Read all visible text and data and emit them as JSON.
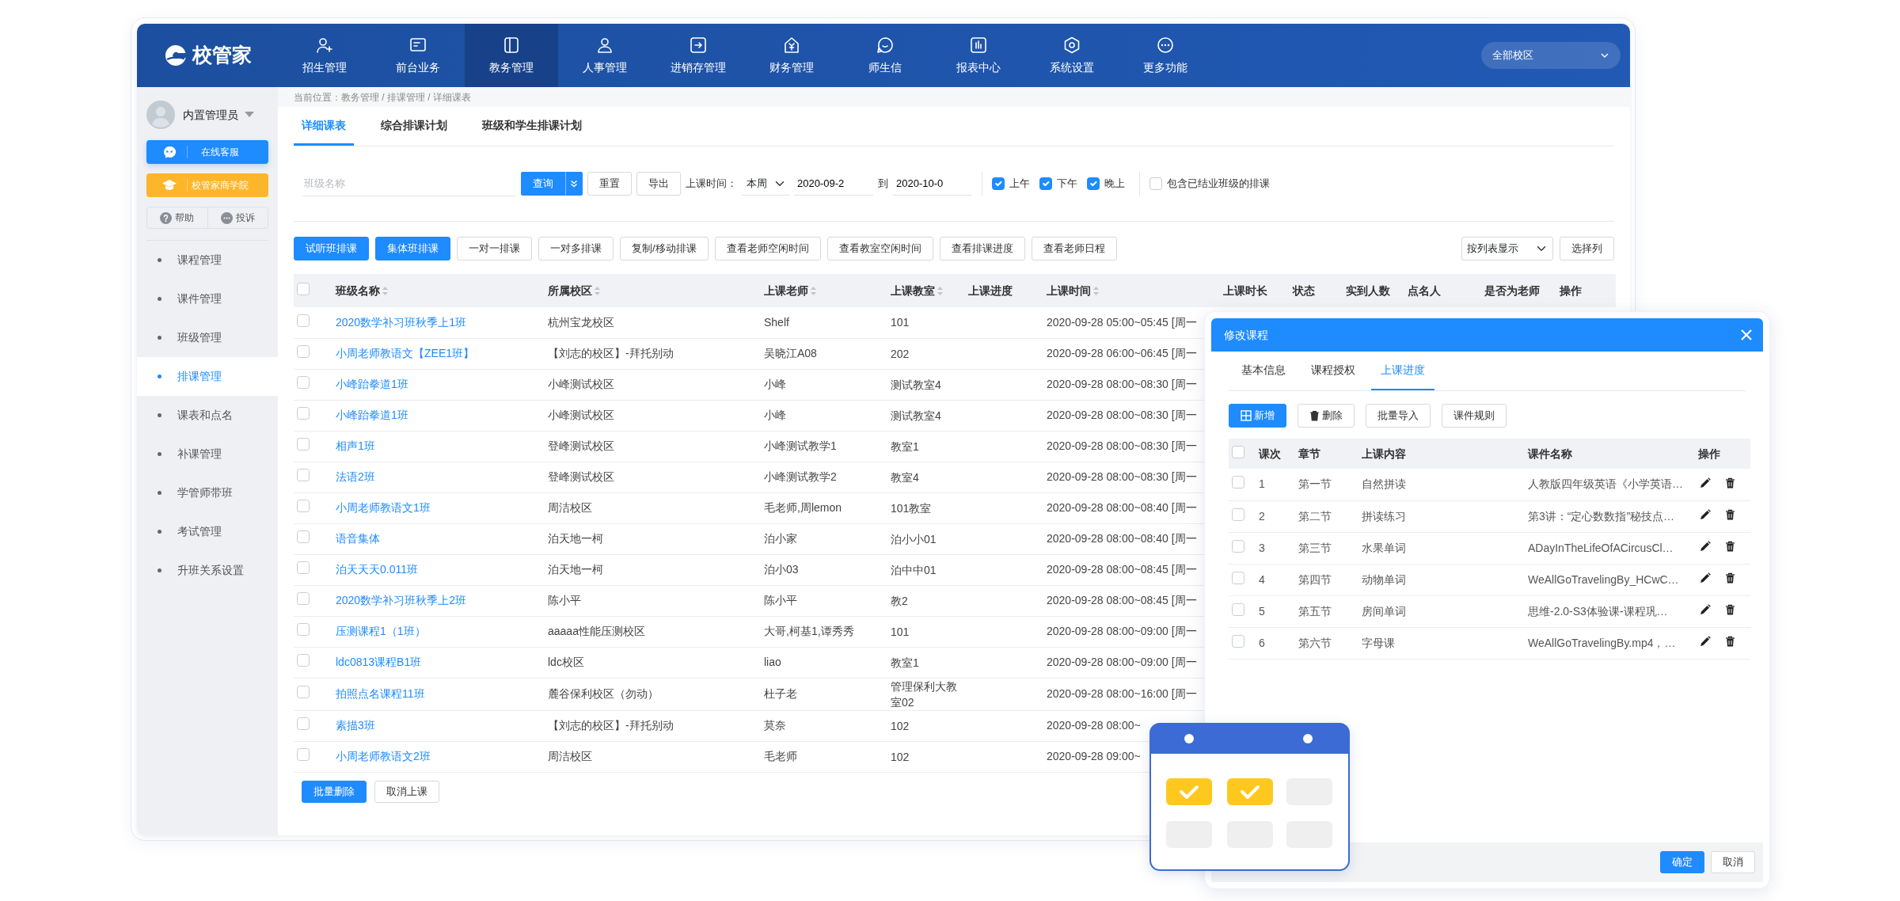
{
  "brand": "校管家",
  "nav": {
    "items": [
      {
        "label": "招生管理",
        "selected": false
      },
      {
        "label": "前台业务",
        "selected": false
      },
      {
        "label": "教务管理",
        "selected": true
      },
      {
        "label": "人事管理",
        "selected": false
      },
      {
        "label": "进销存管理",
        "selected": false
      },
      {
        "label": "财务管理",
        "selected": false
      },
      {
        "label": "师生信",
        "selected": false
      },
      {
        "label": "报表中心",
        "selected": false
      },
      {
        "label": "系统设置",
        "selected": false
      },
      {
        "label": "更多功能",
        "selected": false
      }
    ],
    "campus": "全部校区"
  },
  "sidebar": {
    "user": "内置管理员",
    "service": "在线客服",
    "academy": "校管家商学院",
    "help": "帮助",
    "complaint": "投诉",
    "menu": [
      {
        "label": "课程管理",
        "selected": false
      },
      {
        "label": "课件管理",
        "selected": false
      },
      {
        "label": "班级管理",
        "selected": false
      },
      {
        "label": "排课管理",
        "selected": true
      },
      {
        "label": "课表和点名",
        "selected": false
      },
      {
        "label": "补课管理",
        "selected": false
      },
      {
        "label": "学管师带班",
        "selected": false
      },
      {
        "label": "考试管理",
        "selected": false
      },
      {
        "label": "升班关系设置",
        "selected": false
      }
    ]
  },
  "breadcrumb": "当前位置：教务管理 / 排课管理 / 详细课表",
  "tabs": [
    {
      "label": "详细课表",
      "selected": true
    },
    {
      "label": "综合排课计划",
      "selected": false
    },
    {
      "label": "班级和学生排课计划",
      "selected": false
    }
  ],
  "filters": {
    "placeholder": "班级名称",
    "query": "查询",
    "reset": "重置",
    "export": "导出",
    "time_label": "上课时间：",
    "period": "本周",
    "date_from": "2020-09-2",
    "to": "到",
    "date_to": "2020-10-0",
    "periods": [
      {
        "label": "上午",
        "checked": true
      },
      {
        "label": "下午",
        "checked": true
      },
      {
        "label": "晚上",
        "checked": true
      }
    ],
    "include_ended": {
      "label": "包含已结业班级的排课",
      "checked": false
    }
  },
  "actions": [
    {
      "label": "试听班排课",
      "kind": "primary"
    },
    {
      "label": "集体班排课",
      "kind": "primary"
    },
    {
      "label": "一对一排课",
      "kind": "default"
    },
    {
      "label": "一对多排课",
      "kind": "default"
    },
    {
      "label": "复制/移动排课",
      "kind": "default"
    },
    {
      "label": "查看老师空闲时间",
      "kind": "default"
    },
    {
      "label": "查看教室空闲时间",
      "kind": "default"
    },
    {
      "label": "查看排课进度",
      "kind": "default"
    },
    {
      "label": "查看老师日程",
      "kind": "default"
    }
  ],
  "view_mode": "按列表显示",
  "choose_columns": "选择列",
  "table": {
    "all_checked": false,
    "columns": [
      {
        "label": "班级名称",
        "sortable": true
      },
      {
        "label": "所属校区",
        "sortable": true
      },
      {
        "label": "上课老师",
        "sortable": true
      },
      {
        "label": "上课教室",
        "sortable": true
      },
      {
        "label": "上课进度",
        "sortable": false
      },
      {
        "label": "上课时间",
        "sortable": true
      },
      {
        "label": "上课时长",
        "sortable": false
      },
      {
        "label": "状态",
        "sortable": false
      },
      {
        "label": "实到人数",
        "sortable": false
      },
      {
        "label": "点名人",
        "sortable": false
      },
      {
        "label": "是否为老师",
        "sortable": false
      },
      {
        "label": "操作",
        "sortable": false
      }
    ],
    "rows": [
      {
        "checked": false,
        "class": "2020数学补习班秋季上1班",
        "campus": "杭州宝龙校区",
        "teacher": "Shelf",
        "room": "101",
        "time": "2020-09-28 05:00~05:45 [周一"
      },
      {
        "checked": false,
        "class": "小周老师教语文【ZEE1班】",
        "campus": "【刘志的校区】-拜托别动",
        "teacher": "吴晓江A08",
        "room": "202",
        "time": "2020-09-28 06:00~06:45 [周一"
      },
      {
        "checked": false,
        "class": "小峰跆拳道1班",
        "campus": "小峰测试校区",
        "teacher": "小峰",
        "room": "测试教室4",
        "time": "2020-09-28 08:00~08:30 [周一"
      },
      {
        "checked": false,
        "class": "小峰跆拳道1班",
        "campus": "小峰测试校区",
        "teacher": "小峰",
        "room": "测试教室4",
        "time": "2020-09-28 08:00~08:30 [周一"
      },
      {
        "checked": false,
        "class": "相声1班",
        "campus": "登峰测试校区",
        "teacher": "小峰测试教学1",
        "room": "教室1",
        "time": "2020-09-28 08:00~08:30 [周一"
      },
      {
        "checked": false,
        "class": "法语2班",
        "campus": "登峰测试校区",
        "teacher": "小峰测试教学2",
        "room": "教室4",
        "time": "2020-09-28 08:00~08:30 [周一"
      },
      {
        "checked": false,
        "class": "小周老师教语文1班",
        "campus": "周洁校区",
        "teacher": "毛老师,周lemon",
        "room": "101教室",
        "time": "2020-09-28 08:00~08:40 [周一"
      },
      {
        "checked": false,
        "class": "语音集体",
        "campus": "泊天地一柯",
        "teacher": "泊小家",
        "room": "泊小小01",
        "time": "2020-09-28 08:00~08:40 [周一"
      },
      {
        "checked": false,
        "class": "泊天天天0.011班",
        "campus": "泊天地一柯",
        "teacher": "泊小03",
        "room": "泊中中01",
        "time": "2020-09-28 08:00~08:45 [周一"
      },
      {
        "checked": false,
        "class": "2020数学补习班秋季上2班",
        "campus": "陈小平",
        "teacher": "陈小平",
        "room": "教2",
        "time": "2020-09-28 08:00~08:45 [周一"
      },
      {
        "checked": false,
        "class": "压测课程1（1班）",
        "campus": "aaaaa性能压测校区",
        "teacher": "大哥,柯基1,谭秀秀",
        "room": "101",
        "time": "2020-09-28 08:00~09:00 [周一"
      },
      {
        "checked": false,
        "class": "ldc0813课程B1班",
        "campus": "ldc校区",
        "teacher": "liao",
        "room": "教室1",
        "time": "2020-09-28 08:00~09:00 [周一"
      },
      {
        "checked": false,
        "class": "拍照点名课程11班",
        "campus": "麓谷保利校区（勿动）",
        "teacher": "杜子老",
        "room": "管理保利大教室02",
        "time": "2020-09-28 08:00~16:00 [周一"
      },
      {
        "checked": false,
        "class": "素描3班",
        "campus": "【刘志的校区】-拜托别动",
        "teacher": "莫奈",
        "room": "102",
        "time": "2020-09-28 08:00~"
      },
      {
        "checked": false,
        "class": "小周老师教语文2班",
        "campus": "周洁校区",
        "teacher": "毛老师",
        "room": "102",
        "time": "2020-09-28 09:00~"
      }
    ]
  },
  "bulk_buttons": [
    {
      "label": "批量删除",
      "kind": "primary"
    },
    {
      "label": "取消上课",
      "kind": "default"
    }
  ],
  "modal": {
    "title": "修改课程",
    "all_checked": false,
    "tabs": [
      {
        "label": "基本信息",
        "selected": false
      },
      {
        "label": "课程授权",
        "selected": false
      },
      {
        "label": "上课进度",
        "selected": true
      }
    ],
    "buttons": [
      {
        "label": "新增",
        "kind": "add"
      },
      {
        "label": "删除",
        "kind": "delete"
      },
      {
        "label": "批量导入",
        "kind": "plain"
      },
      {
        "label": "课件规则",
        "kind": "plain"
      }
    ],
    "columns": [
      "课次",
      "章节",
      "上课内容",
      "课件名称",
      "操作"
    ],
    "rows": [
      {
        "checked": false,
        "no": "1",
        "chapter": "第一节",
        "content": "自然拼读",
        "file": "人教版四年级英语《小学英语…"
      },
      {
        "checked": false,
        "no": "2",
        "chapter": "第二节",
        "content": "拼读练习",
        "file": "第3讲：“定心数数指”秘技点…"
      },
      {
        "checked": false,
        "no": "3",
        "chapter": "第三节",
        "content": "水果单词",
        "file": "ADayInTheLifeOfACircusCl…"
      },
      {
        "checked": false,
        "no": "4",
        "chapter": "第四节",
        "content": "动物单词",
        "file": "WeAllGoTravelingBy_HCwC…"
      },
      {
        "checked": false,
        "no": "5",
        "chapter": "第五节",
        "content": "房间单词",
        "file": "思维-2.0-S3体验课-课程巩…"
      },
      {
        "checked": false,
        "no": "6",
        "chapter": "第六节",
        "content": "字母课",
        "file": "WeAllGoTravelingBy.mp4，…"
      }
    ],
    "confirm": "确定",
    "cancel": "取消"
  }
}
